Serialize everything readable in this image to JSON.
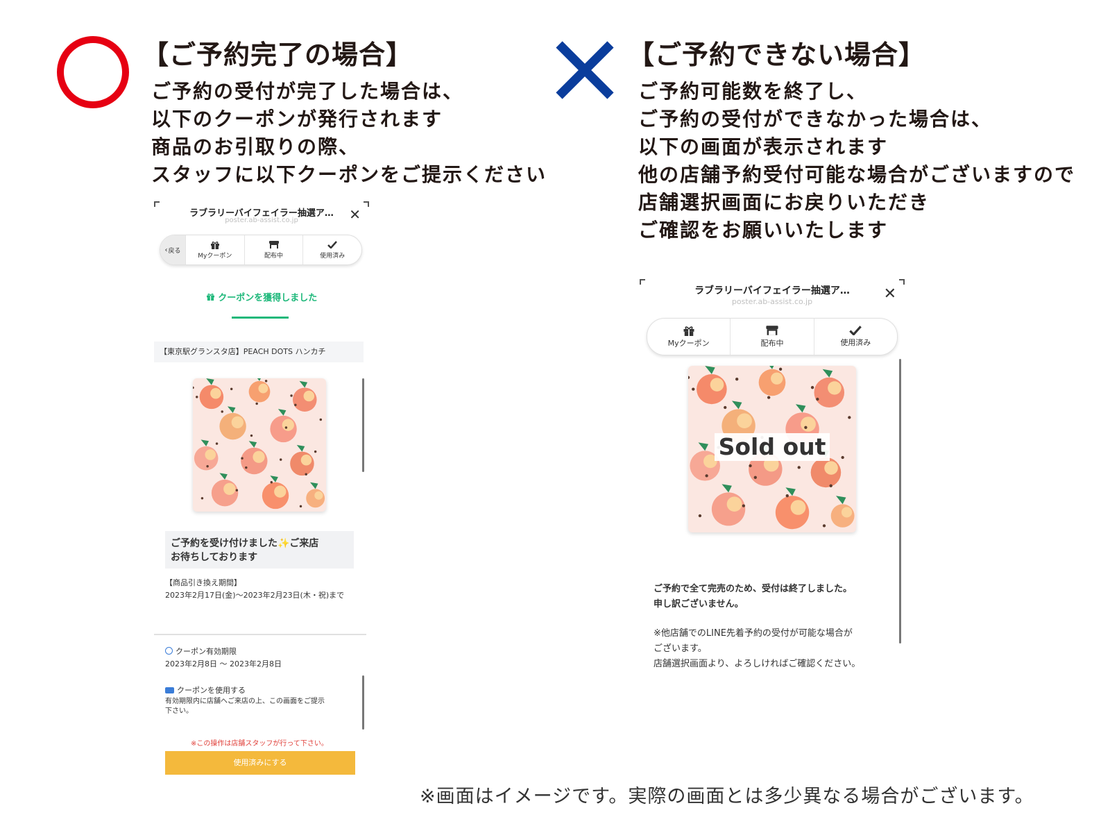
{
  "left": {
    "mark": "○",
    "title": "【ご予約完了の場合】",
    "description": [
      "ご予約の受付が完了した場合は、",
      "以下のクーポンが発行されます",
      "商品のお引取りの際、",
      "スタッフに以下クーポンをご提示ください"
    ],
    "phone": {
      "title": "ラブラリーバイフェイラー抽選ア…",
      "url": "poster.ab-assist.co.jp",
      "back_label": "戻る",
      "tabs": [
        {
          "label": "Myクーポン",
          "icon": "gift-icon"
        },
        {
          "label": "配布中",
          "icon": "shop-icon"
        },
        {
          "label": "使用済み",
          "icon": "check-icon"
        }
      ],
      "acquired_label": "クーポンを獲得しました",
      "product_name": "【東京駅グランスタ店】PEACH DOTS ハンカチ",
      "message": [
        "ご予約を受け付けました✨ご来店",
        "お待ちしております"
      ],
      "exchange_label": "【商品引き換え期間】",
      "exchange_period": "2023年2月17日(金)～2023年2月23日(木・祝)まで",
      "validity_label": "クーポン有効期限",
      "validity_value": "2023年2月8日 ～ 2023年2月8日",
      "use_label": "クーポンを使用する",
      "use_note": [
        "有効期限内に店舗へご来店の上、この画面をご提示",
        "下さい。"
      ],
      "staff_warning": "※この操作は店舗スタッフが行って下さい。",
      "use_button": "使用済みにする"
    }
  },
  "right": {
    "mark": "×",
    "title": "【ご予約できない場合】",
    "description": [
      "ご予約可能数を終了し、",
      "ご予約の受付ができなかった場合は、",
      "以下の画面が表示されます",
      "他の店舗予約受付可能な場合がございますので",
      "店舗選択画面にお戻りいただき",
      "ご確認をお願いいたします"
    ],
    "phone": {
      "title": "ラブラリーバイフェイラー抽選ア…",
      "url": "poster.ab-assist.co.jp",
      "tabs": [
        {
          "label": "Myクーポン",
          "icon": "gift-icon"
        },
        {
          "label": "配布中",
          "icon": "shop-icon"
        },
        {
          "label": "使用済み",
          "icon": "check-icon"
        }
      ],
      "sold_out": "Sold out",
      "message": [
        "ご予約で全て完売のため、受付は終了しました。",
        "申し訳ございません。"
      ],
      "note": [
        "※他店舗でのLINE先着予約の受付が可能な場合が",
        "ございます。",
        "店舗選択画面より、よろしければご確認ください。"
      ]
    }
  },
  "footer_note": "※画面はイメージです。実際の画面とは多少異なる場合がございます。",
  "colors": {
    "ok": "#e60012",
    "ng": "#0a3d9c",
    "accent_green": "#1db87a",
    "button_yellow": "#f4b93c",
    "warning_red": "#e0403a"
  }
}
